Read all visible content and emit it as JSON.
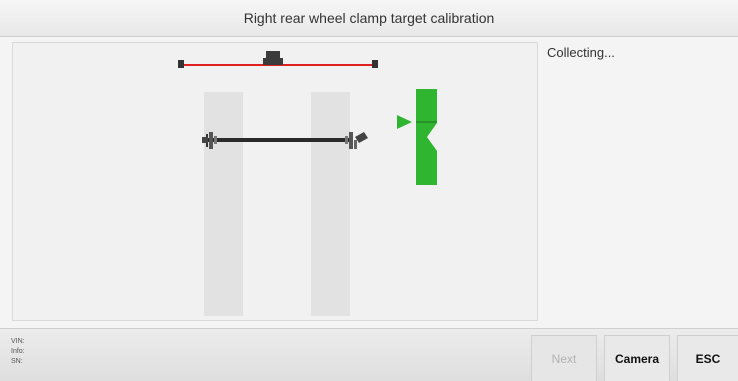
{
  "header": {
    "title": "Right rear wheel clamp target calibration"
  },
  "status": {
    "text": "Collecting..."
  },
  "footer": {
    "vin_label": "VIN:",
    "info_label": "Info:",
    "sn_label": "SN:"
  },
  "buttons": {
    "next_label": "Next",
    "camera_label": "Camera",
    "esc_label": "ESC"
  },
  "colors": {
    "camera_beam": "#e02020",
    "target_indicator": "#2fb52f",
    "lane": "#e2e2e2"
  }
}
